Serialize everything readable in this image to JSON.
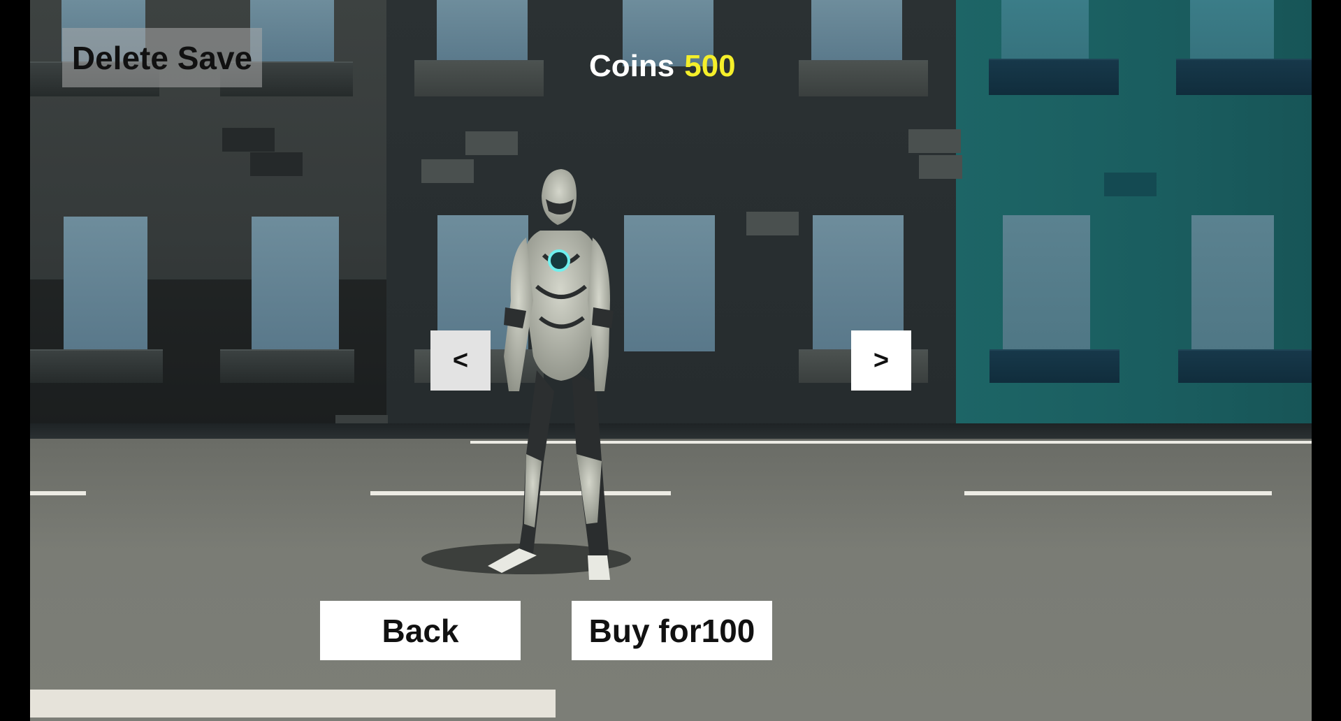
{
  "hud": {
    "delete_save_label": "Delete Save",
    "coins_label": "Coins",
    "coins_value": "500"
  },
  "selector": {
    "prev_label": "<",
    "next_label": ">"
  },
  "actions": {
    "back_label": "Back",
    "buy_label": "Buy for100"
  },
  "progress": {
    "fraction": 0.41
  },
  "colors": {
    "coins_value": "#f5ef2a",
    "coins_label": "#ffffff",
    "button_bg": "#ffffff",
    "button_text": "#111111"
  }
}
